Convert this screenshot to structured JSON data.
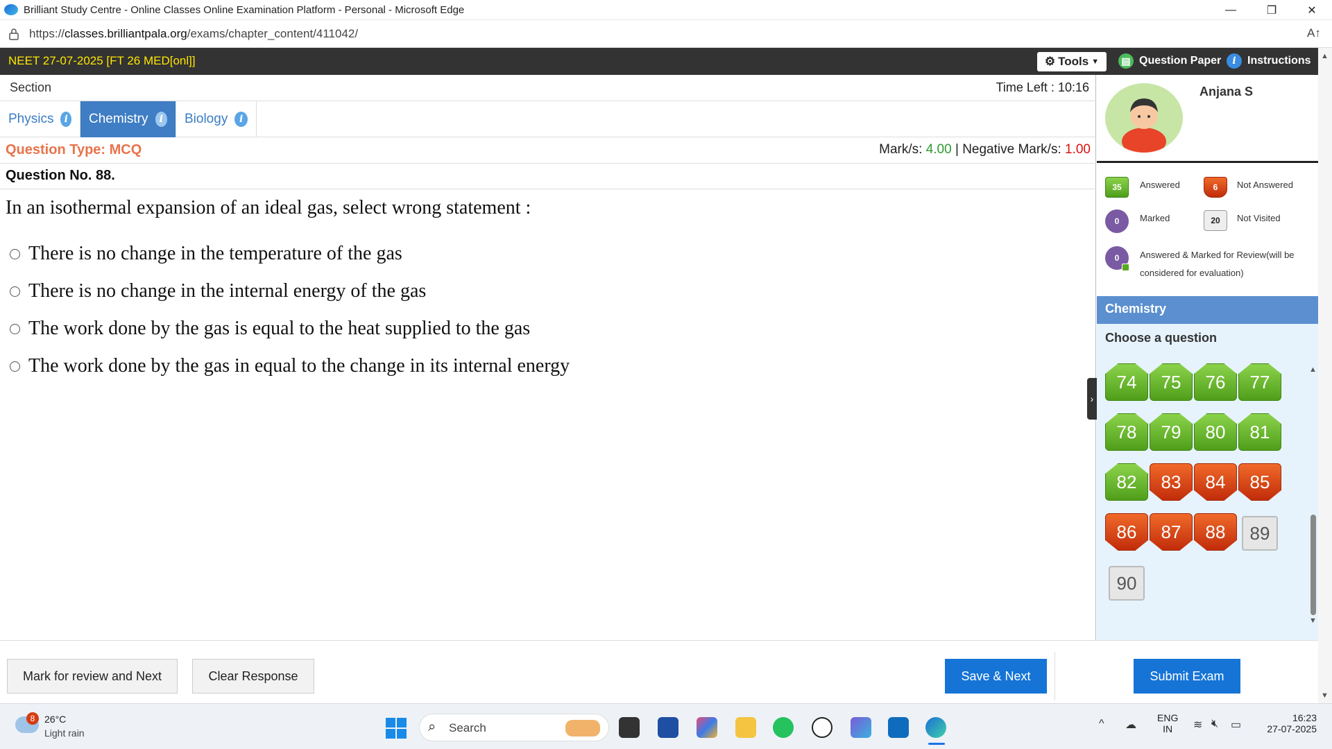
{
  "browser": {
    "window_title": "Brilliant Study Centre - Online Classes Online Examination Platform - Personal - Microsoft Edge",
    "url_prefix": "https://",
    "url_domain": "classes.brilliantpala.org",
    "url_path": "/exams/chapter_content/411042/",
    "read_aloud_icon": "A↑",
    "minimize_icon": "—",
    "restore_icon": "❐",
    "close_icon": "✕"
  },
  "exam": {
    "title": "NEET 27-07-2025 [FT 26 MED[onl]]",
    "tools_label": "Tools",
    "question_paper_label": "Question Paper",
    "instructions_label": "Instructions"
  },
  "section": {
    "label": "Section",
    "time_left_label": "Time Left :",
    "time_left_value": "10:16",
    "tabs": [
      {
        "label": "Physics"
      },
      {
        "label": "Chemistry"
      },
      {
        "label": "Biology"
      }
    ]
  },
  "question": {
    "type_label": "Question Type: MCQ",
    "marks_label": "Mark/s:",
    "marks_value": "4.00",
    "separator": "|",
    "negative_label": "Negative Mark/s:",
    "negative_value": "1.00",
    "number_label": "Question No. 88.",
    "text": "In an isothermal expansion of an ideal gas, select wrong statement :",
    "options": [
      "There is no change in the temperature of the gas",
      "There is no change in the internal energy of the gas",
      "The work done by the gas is equal to the heat supplied to the gas",
      "The work done by the gas in equal to the change in its internal energy"
    ]
  },
  "candidate": {
    "name": "Anjana S"
  },
  "legend": {
    "answered_count": "35",
    "answered_label": "Answered",
    "not_answered_count": "6",
    "not_answered_label": "Not Answered",
    "marked_count": "0",
    "marked_label": "Marked",
    "not_visited_count": "20",
    "not_visited_label": "Not Visited",
    "answered_marked_count": "0",
    "answered_marked_label_1": "Answered & Marked for Review(will be",
    "answered_marked_label_2": "considered for evaluation)"
  },
  "palette": {
    "section_name": "Chemistry",
    "choose_label": "Choose a question",
    "questions": [
      {
        "n": "74",
        "status": "answered"
      },
      {
        "n": "75",
        "status": "answered"
      },
      {
        "n": "76",
        "status": "answered"
      },
      {
        "n": "77",
        "status": "answered"
      },
      {
        "n": "78",
        "status": "answered"
      },
      {
        "n": "79",
        "status": "answered"
      },
      {
        "n": "80",
        "status": "answered"
      },
      {
        "n": "81",
        "status": "answered"
      },
      {
        "n": "82",
        "status": "answered"
      },
      {
        "n": "83",
        "status": "not-answered"
      },
      {
        "n": "84",
        "status": "not-answered"
      },
      {
        "n": "85",
        "status": "not-answered"
      },
      {
        "n": "86",
        "status": "not-answered"
      },
      {
        "n": "87",
        "status": "not-answered"
      },
      {
        "n": "88",
        "status": "not-answered"
      },
      {
        "n": "89",
        "status": "not-visited"
      },
      {
        "n": "90",
        "status": "not-visited"
      }
    ]
  },
  "actions": {
    "mark_review_label": "Mark for review and Next",
    "clear_label": "Clear Response",
    "save_next_label": "Save & Next",
    "submit_label": "Submit Exam"
  },
  "taskbar": {
    "weather_badge": "8",
    "weather_temp": "26°C",
    "weather_desc": "Light rain",
    "search_placeholder": "Search",
    "lang_1": "ENG",
    "lang_2": "IN",
    "time": "16:23",
    "date": "27-07-2025"
  },
  "colors": {
    "answered": "#5aa922",
    "not_answered": "#d63c12",
    "marked": "#7a5aa3",
    "primary": "#1574d6",
    "tab_active": "#3f7dc4",
    "header_bg": "#333333",
    "exam_title": "#ffe600"
  }
}
